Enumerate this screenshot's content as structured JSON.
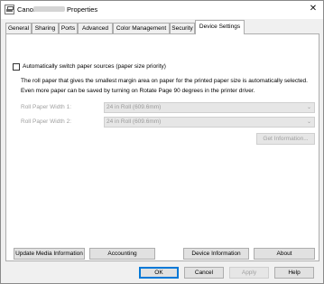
{
  "window": {
    "title_prefix": "Canon",
    "title_suffix": "Properties",
    "close_glyph": "✕"
  },
  "tabs": [
    {
      "label": "General"
    },
    {
      "label": "Sharing"
    },
    {
      "label": "Ports"
    },
    {
      "label": "Advanced"
    },
    {
      "label": "Color Management"
    },
    {
      "label": "Security"
    },
    {
      "label": "Device Settings",
      "active": true
    }
  ],
  "device_settings": {
    "auto_switch_label": "Automatically switch paper sources (paper size priority)",
    "auto_switch_checked": false,
    "description_line1": "The roll paper that gives the smallest margin area on paper for the printed paper size is automatically selected.",
    "description_line2": "Even more paper can be saved by turning on Rotate Page 90 degrees in the printer driver.",
    "roll1_label": "Roll Paper Width 1:",
    "roll1_value": "24 in Roll (609.6mm)",
    "roll2_label": "Roll Paper Width 2:",
    "roll2_value": "24 in Roll (609.6mm)",
    "get_info_label": "Get Information...",
    "update_media_label": "Update Media Information",
    "accounting_label": "Accounting",
    "device_info_label": "Device Information",
    "about_label": "About"
  },
  "footer": {
    "ok_label": "OK",
    "cancel_label": "Cancel",
    "apply_label": "Apply",
    "help_label": "Help"
  },
  "colors": {
    "focus_border": "#0078d7",
    "disabled_text": "#a0a0a0"
  }
}
